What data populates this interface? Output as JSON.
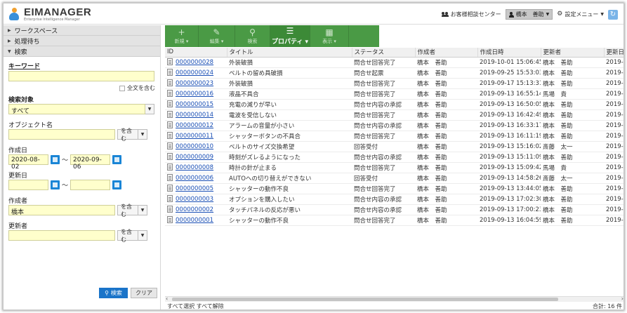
{
  "header": {
    "logo_name": "EIMANAGER",
    "logo_sub": "Enterprise Intelligence Manager",
    "support_center": "お客様相談センター",
    "user_name": "橋本　善助",
    "settings_menu": "設定メニュー"
  },
  "sidebar": {
    "accordion": [
      "ワークスペース",
      "処理待ち",
      "検索"
    ],
    "keyword_label": "キーワード",
    "keyword_value": "",
    "fulltext_label": "全文を含む",
    "target_label": "検索対象",
    "target_value": "すべて",
    "object_name_label": "オブジェクト名",
    "object_name_value": "",
    "contains_option": "を含む",
    "created_date_label": "作成日",
    "created_from": "2020-08-02",
    "created_to": "2020-09-06",
    "updated_date_label": "更新日",
    "updated_from": "",
    "updated_to": "",
    "creator_label": "作成者",
    "creator_value": "橋本",
    "updater_label": "更新者",
    "updater_value": "",
    "tilde": "～",
    "search_button": "検索",
    "clear_button": "クリア"
  },
  "toolbar": [
    {
      "icon": "plus-icon",
      "glyph": "+",
      "label": "新規 ▾",
      "active": false
    },
    {
      "icon": "pencil-icon",
      "glyph": "✎",
      "label": "編集 ▾",
      "active": false
    },
    {
      "icon": "search-icon",
      "glyph": "⚲",
      "label": "検索",
      "active": false
    },
    {
      "icon": "list-icon",
      "glyph": "☰",
      "label": "プロパティ ▾",
      "active": true
    },
    {
      "icon": "table-icon",
      "glyph": "▦",
      "label": "表示 ▾",
      "active": false
    }
  ],
  "table": {
    "columns": [
      "ID",
      "タイトル",
      "ステータス",
      "作成者",
      "作成日時",
      "更新者",
      "更新日"
    ],
    "rows": [
      [
        "0000000028",
        "外装破損",
        "問合せ回答完了",
        "橋本　善助",
        "2019-10-01 15:06:45",
        "橋本　善助",
        "2019-1"
      ],
      [
        "0000000024",
        "ベルトの留め具破損",
        "問合せ起票",
        "橋本　善助",
        "2019-09-25 15:53:03",
        "橋本　善助",
        "2019-0"
      ],
      [
        "0000000023",
        "外装破損",
        "問合せ回答完了",
        "橋本　善助",
        "2019-09-17 15:13:31",
        "橋本　善助",
        "2019-1"
      ],
      [
        "0000000016",
        "液晶不具合",
        "問合せ回答完了",
        "橋本　善助",
        "2019-09-13 16:55:14",
        "馬場　貴",
        "2019-0"
      ],
      [
        "0000000015",
        "充電の減りが早い",
        "問合せ内容の承認",
        "橋本　善助",
        "2019-09-13 16:50:05",
        "橋本　善助",
        "2019-0"
      ],
      [
        "0000000014",
        "電波を受信しない",
        "問合せ回答完了",
        "橋本　善助",
        "2019-09-13 16:42:49",
        "橋本　善助",
        "2019-0"
      ],
      [
        "0000000012",
        "アラームの音量が小さい",
        "問合せ内容の承認",
        "橋本　善助",
        "2019-09-13 16:33:17",
        "橋本　善助",
        "2019-0"
      ],
      [
        "0000000011",
        "シャッターボタンの不具合",
        "問合せ回答完了",
        "橋本　善助",
        "2019-09-13 16:11:19",
        "橋本　善助",
        "2019-0"
      ],
      [
        "0000000010",
        "ベルトのサイズ交換希望",
        "回答受付",
        "橋本　善助",
        "2019-09-13 15:16:02",
        "斎藤　太一",
        "2019-0"
      ],
      [
        "0000000009",
        "時刻がズレるようになった",
        "問合せ内容の承認",
        "橋本　善助",
        "2019-09-13 15:11:09",
        "橋本　善助",
        "2019-0"
      ],
      [
        "0000000008",
        "時計の針が止まる",
        "問合せ回答完了",
        "橋本　善助",
        "2019-09-13 15:09:42",
        "馬場　貴",
        "2019-0"
      ],
      [
        "0000000006",
        "AUTOへの切り替えができない",
        "回答受付",
        "橋本　善助",
        "2019-09-13 14:58:26",
        "斎藤　太一",
        "2019-0"
      ],
      [
        "0000000005",
        "シャッターの動作不良",
        "問合せ回答完了",
        "橋本　善助",
        "2019-09-13 13:44:05",
        "橋本　善助",
        "2019-0"
      ],
      [
        "0000000003",
        "オプションを購入したい",
        "問合せ内容の承認",
        "橋本　善助",
        "2019-09-13 17:02:30",
        "橋本　善助",
        "2019-0"
      ],
      [
        "0000000002",
        "タッチパネルの反応が悪い",
        "問合せ内容の承認",
        "橋本　善助",
        "2019-09-13 17:00:23",
        "橋本　善助",
        "2019-0"
      ],
      [
        "0000000001",
        "シャッターの動作不良",
        "問合せ回答完了",
        "橋本　善助",
        "2019-09-13 16:04:59",
        "橋本　善助",
        "2019-0"
      ]
    ]
  },
  "footer": {
    "select_all": "すべて選択",
    "deselect_all": "すべて解除",
    "total": "合計: 16 件"
  },
  "colors": {
    "toolbar_green": "#4a9a45",
    "input_yellow": "#ffffcc",
    "search_blue": "#1a74c9",
    "link_blue": "#1a4fb5"
  }
}
